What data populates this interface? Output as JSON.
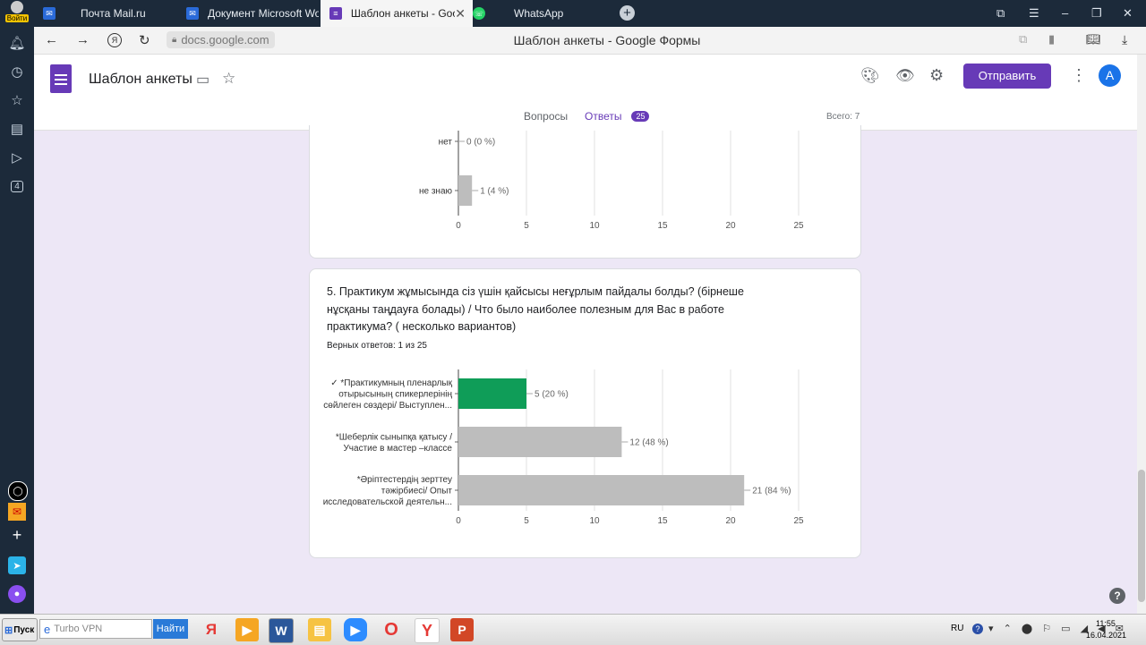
{
  "tabs": [
    {
      "title": "Почта Mail.ru"
    },
    {
      "title": "Документ Microsoft Word..."
    },
    {
      "title": "Шаблон анкеты - Goog"
    },
    {
      "title": "WhatsApp"
    }
  ],
  "browser": {
    "url": "docs.google.com",
    "page_title": "Шаблон анкеты - Google Формы",
    "login": "Войти"
  },
  "form": {
    "title": "Шаблон анкеты",
    "send_label": "Отправить",
    "avatar": "A",
    "tab_questions": "Вопросы",
    "tab_answers": "Ответы",
    "answers_count": "25",
    "total_label": "Всего: 7"
  },
  "sidebar": {
    "badge": "4"
  },
  "charts": {
    "top": {
      "categories": [
        "нет",
        "не знаю"
      ],
      "value_labels": [
        "0 (0 %)",
        "1 (4 %)"
      ]
    },
    "bottom": {
      "question": "5. Практикум жұмысында сіз үшін қайсысы неғұрлым пайдалы болды? (бірнеше нұсқаны таңдауға болады) / Что было наиболее полезным для Вас в работе практикума? ( несколько вариантов)",
      "correct_text": "Верных ответов: 1 из 25",
      "categories": [
        [
          "✓ *Практикумның пленарлық",
          "отырысының спикерлерінің",
          "сөйлеген сөздері/ Выступлен..."
        ],
        [
          "*Шеберлік сыныпқа қатысу /",
          "Участие в мастер –классе"
        ],
        [
          "*Әріптестердің зерттеу",
          "тәжірбиесі/ Опыт",
          "исследовательской деятельн..."
        ]
      ],
      "value_labels": [
        "5 (20 %)",
        "12 (48 %)",
        "21 (84 %)"
      ]
    },
    "ticks": [
      "0",
      "5",
      "10",
      "15",
      "20",
      "25"
    ]
  },
  "chart_data": [
    {
      "type": "bar",
      "orientation": "horizontal",
      "categories": [
        "нет",
        "не знаю"
      ],
      "values": [
        0,
        1
      ],
      "xlim": [
        0,
        25
      ],
      "grid": true
    },
    {
      "type": "bar",
      "orientation": "horizontal",
      "title": "5. Практикум жұмысында сіз үшін қайсысы неғұрлым пайдалы болды? (бірнеше нұсқаны таңдауға болады) / Что было наиболее полезным для Вас в работе практикума? ( несколько вариантов)",
      "categories": [
        "✓ *Практикумның пленарлық отырысының спикерлерінің сөйлеген сөздері/ Выступлен...",
        "*Шеберлік сыныпқа қатысу / Участие в мастер –классе",
        "*Әріптестердің зерттеу тәжірбиесі/ Опыт исследовательской деятельн..."
      ],
      "values": [
        5,
        12,
        21
      ],
      "xlim": [
        0,
        25
      ],
      "grid": true,
      "colors": [
        "#0f9d58",
        "#bdbdbd",
        "#bdbdbd"
      ]
    }
  ],
  "taskbar": {
    "start": "Пуск",
    "search_placeholder": "Turbo VPN",
    "search_btn": "Найти",
    "lang": "RU",
    "time": "11:55",
    "date": "16.04.2021"
  },
  "colors": {
    "accent": "#673ab7",
    "correct": "#0f9d58",
    "bar": "#bdbdbd"
  }
}
